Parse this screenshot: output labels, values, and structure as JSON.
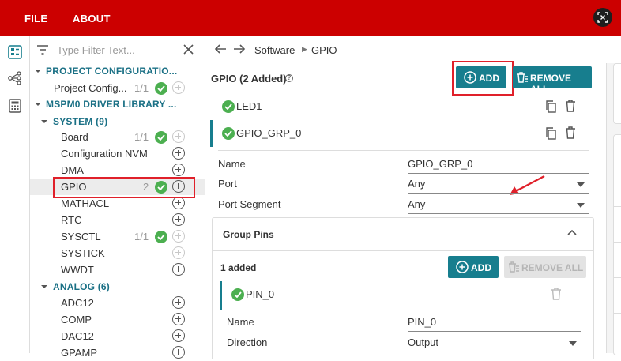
{
  "menu": {
    "file": "FILE",
    "about": "ABOUT"
  },
  "filter": {
    "placeholder": "Type Filter Text..."
  },
  "tree": {
    "project_section": "PROJECT CONFIGURATIO...",
    "project_item": {
      "label": "Project Config...",
      "count": "1/1"
    },
    "driver_section": "MSPM0 DRIVER LIBRARY ...",
    "system_group": "SYSTEM (9)",
    "system_items": [
      {
        "label": "Board",
        "count": "1/1"
      },
      {
        "label": "Configuration NVM",
        "count": ""
      },
      {
        "label": "DMA",
        "count": ""
      },
      {
        "label": "GPIO",
        "count": "2"
      },
      {
        "label": "MATHACL",
        "count": ""
      },
      {
        "label": "RTC",
        "count": ""
      },
      {
        "label": "SYSCTL",
        "count": "1/1"
      },
      {
        "label": "SYSTICK",
        "count": ""
      },
      {
        "label": "WWDT",
        "count": ""
      }
    ],
    "analog_group": "ANALOG (6)",
    "analog_items": [
      {
        "label": "ADC12"
      },
      {
        "label": "COMP"
      },
      {
        "label": "DAC12"
      },
      {
        "label": "GPAMP"
      }
    ]
  },
  "breadcrumb": {
    "software": "Software",
    "gpio": "GPIO"
  },
  "main": {
    "title": "GPIO (2 Added)",
    "help": "?",
    "add_label": "ADD",
    "remove_all_label": "REMOVE ALL",
    "instances": [
      {
        "name": "LED1"
      },
      {
        "name": "GPIO_GRP_0"
      }
    ],
    "fields": {
      "name": {
        "label": "Name",
        "value": "GPIO_GRP_0"
      },
      "port": {
        "label": "Port",
        "value": "Any"
      },
      "port_segment": {
        "label": "Port Segment",
        "value": "Any"
      }
    },
    "group_pins": {
      "title": "Group Pins",
      "count_text": "1 added",
      "add_label": "ADD",
      "remove_all_label": "REMOVE ALL",
      "pin": {
        "name": "PIN_0"
      },
      "pin_fields": {
        "name": {
          "label": "Name",
          "value": "PIN_0"
        },
        "direction": {
          "label": "Direction",
          "value": "Output"
        }
      }
    }
  },
  "colors": {
    "header": "#cc0000",
    "accent": "#177e8e",
    "check": "#4caf50",
    "highlight": "#e0202a"
  },
  "icons": [
    "fit-screen-icon",
    "modules-icon",
    "topology-icon",
    "calculator-icon",
    "filter-icon",
    "clear-icon",
    "back-icon",
    "forward-icon",
    "help-icon",
    "plus-circle-icon",
    "trash-icon",
    "copy-icon",
    "check-icon",
    "chevron-down-icon",
    "chevron-up-icon",
    "dropdown-arrow-icon",
    "red-arrow-annotation"
  ]
}
